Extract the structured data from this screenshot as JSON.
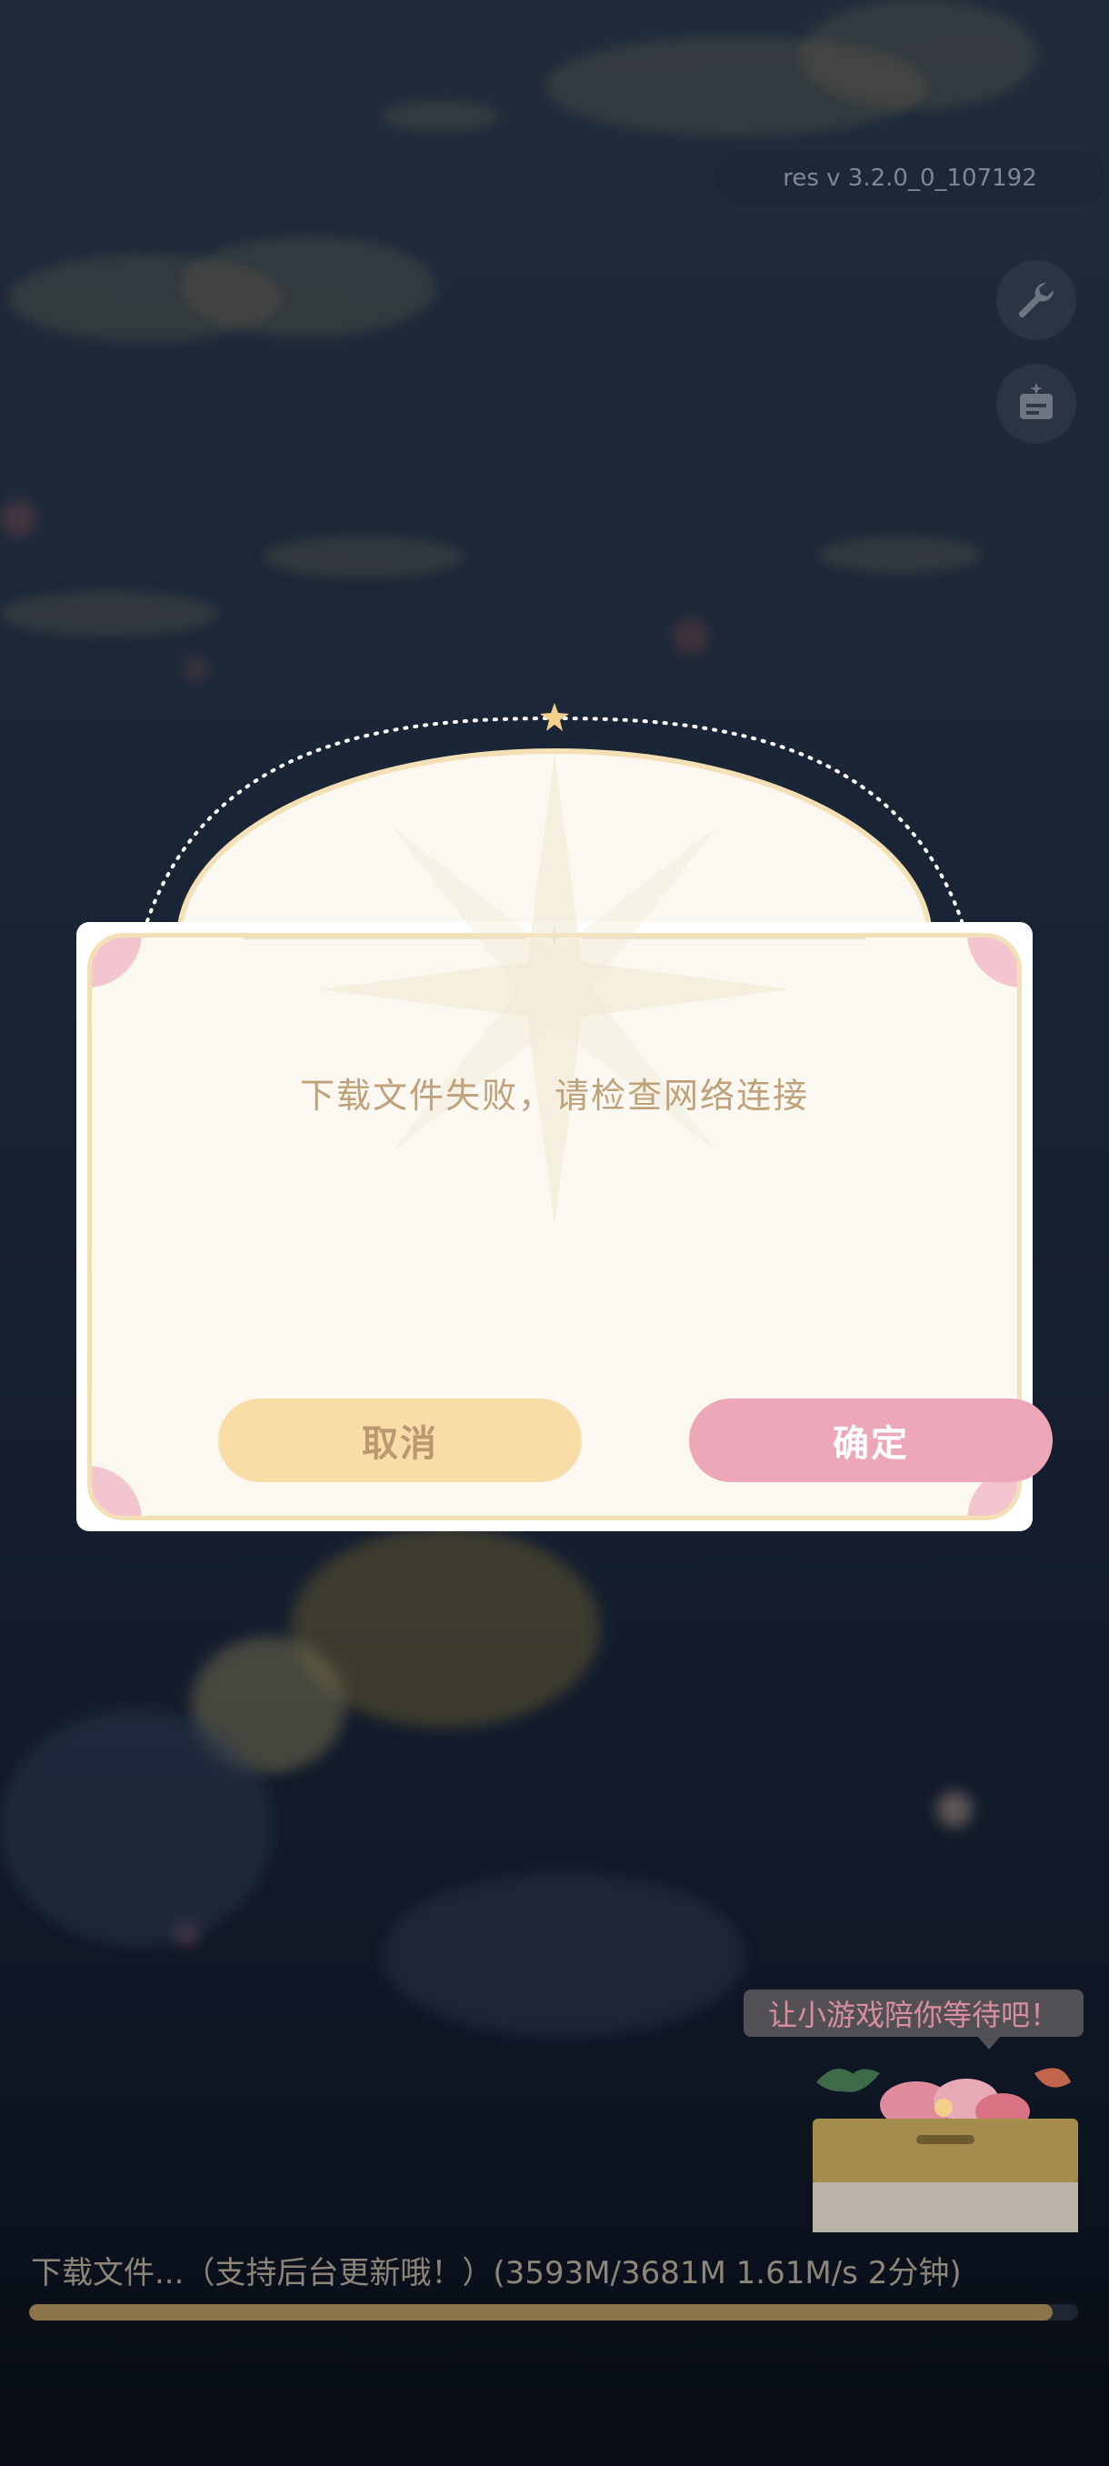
{
  "version_label": "res v 3.2.0_0_107192",
  "side_buttons": [
    {
      "icon": "wrench-icon"
    },
    {
      "icon": "notice-board-icon"
    }
  ],
  "dialog": {
    "message": "下载文件失败，请检查网络连接",
    "cancel_label": "取消",
    "confirm_label": "确定"
  },
  "mini_game": {
    "prompt": "让小游戏陪你等待吧！",
    "icon": "flower-basket-icon"
  },
  "download": {
    "status_text": "下载文件...（支持后台更新哦！）(3593M/3681M 1.61M/s 2分钟)",
    "downloaded": 3593,
    "total": 3681,
    "progress_fraction": 0.976
  },
  "colors": {
    "cancel_button": "#f8dda7",
    "confirm_button": "#eca7b8",
    "dialog_border": "#f3e1b5",
    "message_text": "#bfa27a",
    "progress_fill": "#8b7447"
  }
}
